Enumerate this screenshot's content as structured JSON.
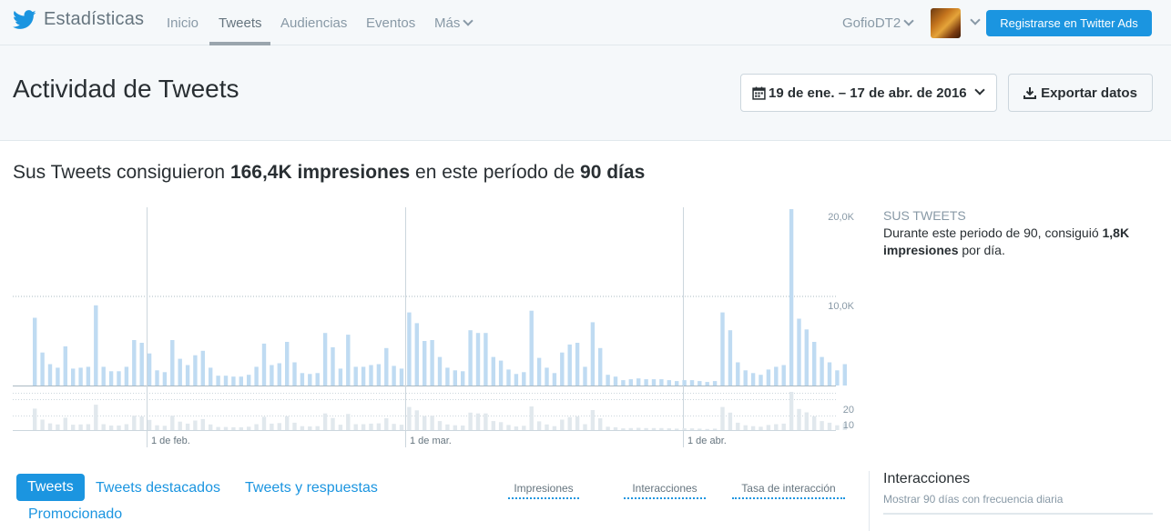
{
  "nav": {
    "brand": "Estadísticas",
    "links": [
      "Inicio",
      "Tweets",
      "Audiencias",
      "Eventos",
      "Más"
    ],
    "user": "GofioDT2",
    "ads_button": "Registrarse en Twitter Ads"
  },
  "header": {
    "title": "Actividad de Tweets",
    "date_range": "19 de ene. – 17 de abr. de 2016",
    "export": "Exportar datos"
  },
  "summary": {
    "prefix": "Sus Tweets consiguieron",
    "impressions": "166,4K impresiones",
    "middle": "en este período de",
    "days": "90 días"
  },
  "sidebar": {
    "title": "SUS TWEETS",
    "text_prefix": "Durante este periodo de 90, consiguió",
    "highlight": "1,8K impresiones",
    "text_suffix": "por día."
  },
  "chart_data": {
    "type": "bar",
    "x_labels": [
      "1 de feb.",
      "1 de mar.",
      "1 de abr."
    ],
    "impressions_ticks": [
      "20,0K",
      "10,0K"
    ],
    "impressions_max": 20000,
    "impressions": [
      7600,
      3700,
      2400,
      2000,
      4400,
      1900,
      2000,
      2100,
      9000,
      2100,
      1600,
      1600,
      2100,
      5100,
      4800,
      3600,
      1700,
      1500,
      5100,
      3000,
      2300,
      3400,
      3900,
      2000,
      1100,
      1100,
      1000,
      1000,
      1200,
      2100,
      4700,
      2300,
      2500,
      4900,
      2600,
      1400,
      1300,
      1400,
      5900,
      4300,
      1900,
      5700,
      2100,
      2100,
      2300,
      2400,
      4200,
      2200,
      1900,
      8200,
      7000,
      5000,
      5100,
      3200,
      2000,
      1700,
      1600,
      6200,
      5900,
      5900,
      3200,
      2800,
      1800,
      1300,
      1500,
      8400,
      3100,
      2000,
      1400,
      3700,
      4600,
      4800,
      2100,
      7100,
      4200,
      1200,
      1000,
      600,
      700,
      800,
      700,
      700,
      700,
      600,
      500,
      600,
      600,
      500,
      400,
      500,
      8200,
      6200,
      2600,
      1700,
      1400,
      1200,
      1800,
      2100,
      2300,
      19800,
      7500,
      6300,
      4900,
      3200,
      2600,
      1700,
      2400
    ]
  }
}
